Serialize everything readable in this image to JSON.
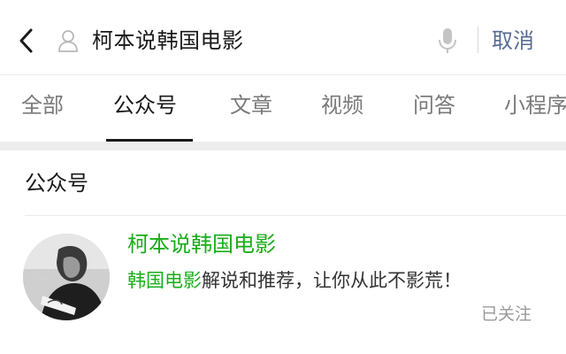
{
  "search": {
    "query": "柯本说韩国电影",
    "cancel_label": "取消"
  },
  "tabs": [
    {
      "label": "全部",
      "active": false
    },
    {
      "label": "公众号",
      "active": true
    },
    {
      "label": "文章",
      "active": false
    },
    {
      "label": "视频",
      "active": false
    },
    {
      "label": "问答",
      "active": false
    },
    {
      "label": "小程序",
      "active": false
    }
  ],
  "section": {
    "title": "公众号"
  },
  "account": {
    "name": "柯本说韩国电影",
    "description_highlight": "韩国电影",
    "description_rest": "解说和推荐，让你从此不影荒！",
    "follow_status": "已关注"
  },
  "colors": {
    "accent_green": "#1aad19",
    "link_blue": "#576b95",
    "active_tab": "#1a1a1a",
    "inactive_tab": "#7a7a7a"
  },
  "icons": {
    "back": "back-arrow-icon",
    "person": "person-icon",
    "mic": "microphone-icon"
  }
}
